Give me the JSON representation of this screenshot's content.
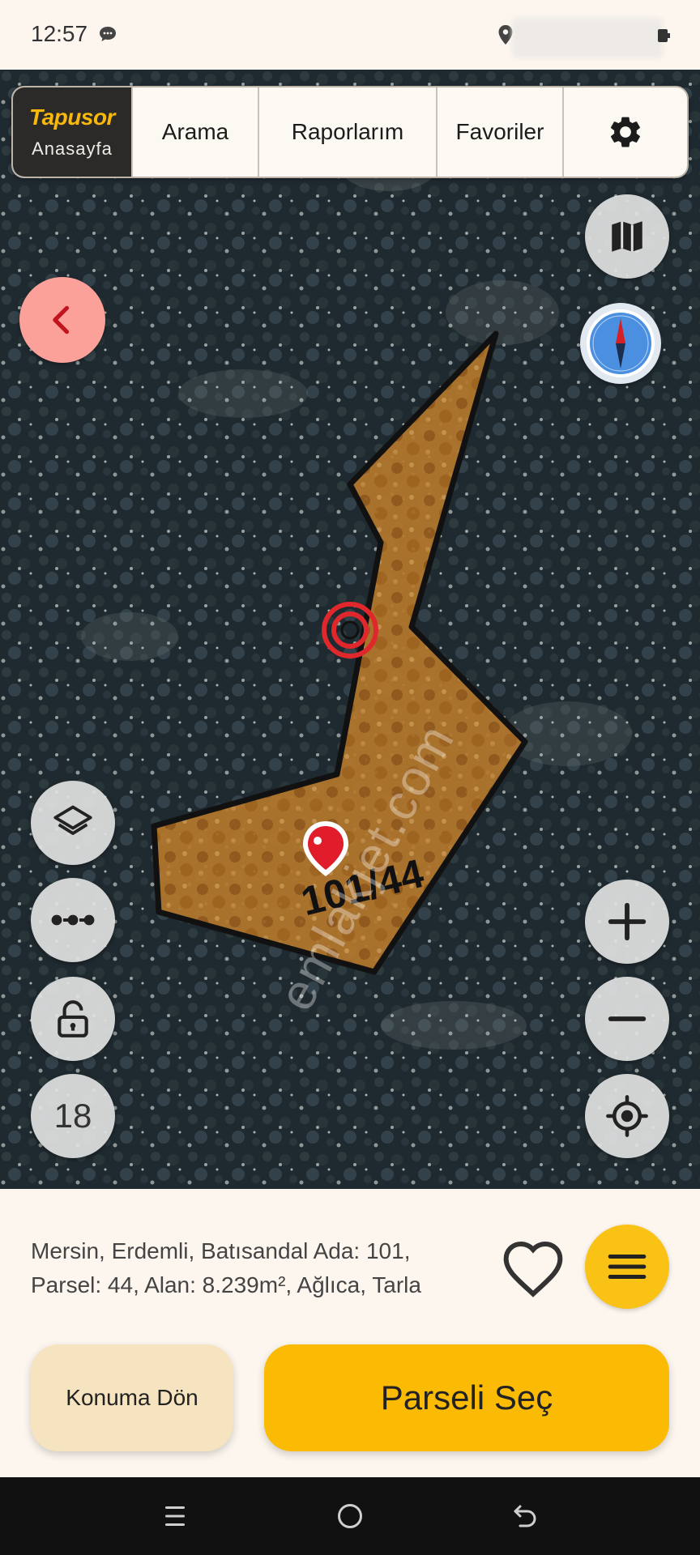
{
  "status_bar": {
    "time": "12:57",
    "icons": [
      "chat-icon",
      "location-icon",
      "battery-icon"
    ]
  },
  "top_nav": {
    "brand_logo": "Tapusor",
    "brand_sub": "Anasayfa",
    "search": "Arama",
    "reports": "Raporlarım",
    "favorites": "Favoriler",
    "settings_icon": "gear-icon"
  },
  "map": {
    "parcel_label": "101/44",
    "watermark": "emlakjet.com",
    "zoom_level": "18",
    "parcel_fill": "#c07a2a",
    "target_color": "#e0272c",
    "pin_color": "#e11d2b"
  },
  "map_controls": {
    "left": [
      "layers-icon",
      "measure-icon",
      "lock-icon"
    ],
    "right": [
      "map-type-icon",
      "compass-icon",
      "plus-icon",
      "minus-icon",
      "my-location-icon"
    ],
    "back": "chevron-left-icon"
  },
  "info": {
    "line1": "Mersin, Erdemli, Batısandal Ada: 101,",
    "line2": "Parsel: 44, Alan: 8.239m², Ağlıca, Tarla"
  },
  "actions": {
    "locate": "Konuma Dön",
    "select": "Parseli Seç"
  },
  "colors": {
    "accent": "#fbbb04",
    "background": "#fcf6ef",
    "brand_dark": "#2c2a28",
    "back_button": "#fca09a"
  }
}
